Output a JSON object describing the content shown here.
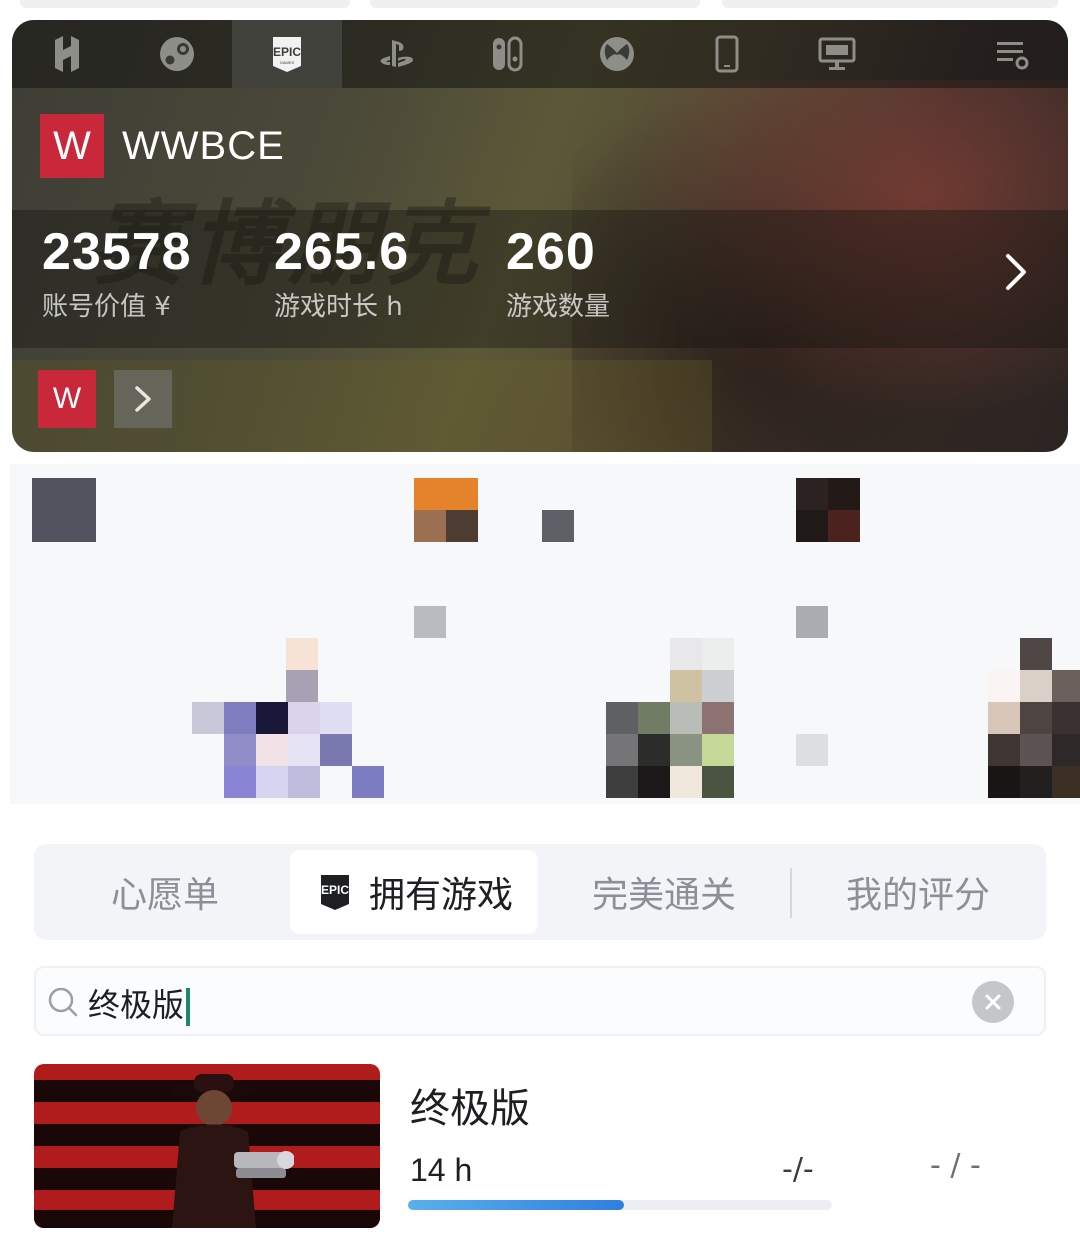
{
  "platform_tabs": [
    {
      "icon": "heybox-icon",
      "active": false
    },
    {
      "icon": "steam-icon",
      "active": false
    },
    {
      "icon": "epic-games-icon",
      "active": true
    },
    {
      "icon": "playstation-icon",
      "active": false
    },
    {
      "icon": "nintendo-switch-icon",
      "active": false
    },
    {
      "icon": "xbox-icon",
      "active": false
    },
    {
      "icon": "mobile-icon",
      "active": false
    },
    {
      "icon": "desktop-icon",
      "active": false
    },
    {
      "icon": "list-settings-icon",
      "active": false
    }
  ],
  "account": {
    "logo_letter": "W",
    "name": "WWBCE",
    "mini_logo_letter": "W"
  },
  "stats": {
    "value": "23578",
    "value_label": "账号价值 ¥",
    "hours": "265.6",
    "hours_label": "游戏时长 h",
    "games": "260",
    "games_label": "游戏数量"
  },
  "hero_art_text": "赛博朋克",
  "segments": {
    "wishlist": "心愿单",
    "owned": "拥有游戏",
    "perfect": "完美通关",
    "my_rating": "我的评分",
    "epic_badge": "EPIC"
  },
  "search": {
    "value": "终极版"
  },
  "game": {
    "title": "终极版",
    "hours": "14 h",
    "achievements": "-/-",
    "score": "- / -",
    "progress": 0.51
  },
  "colors": {
    "accent_red": "#c9283a",
    "progress_blue": "#2f7fe0"
  }
}
